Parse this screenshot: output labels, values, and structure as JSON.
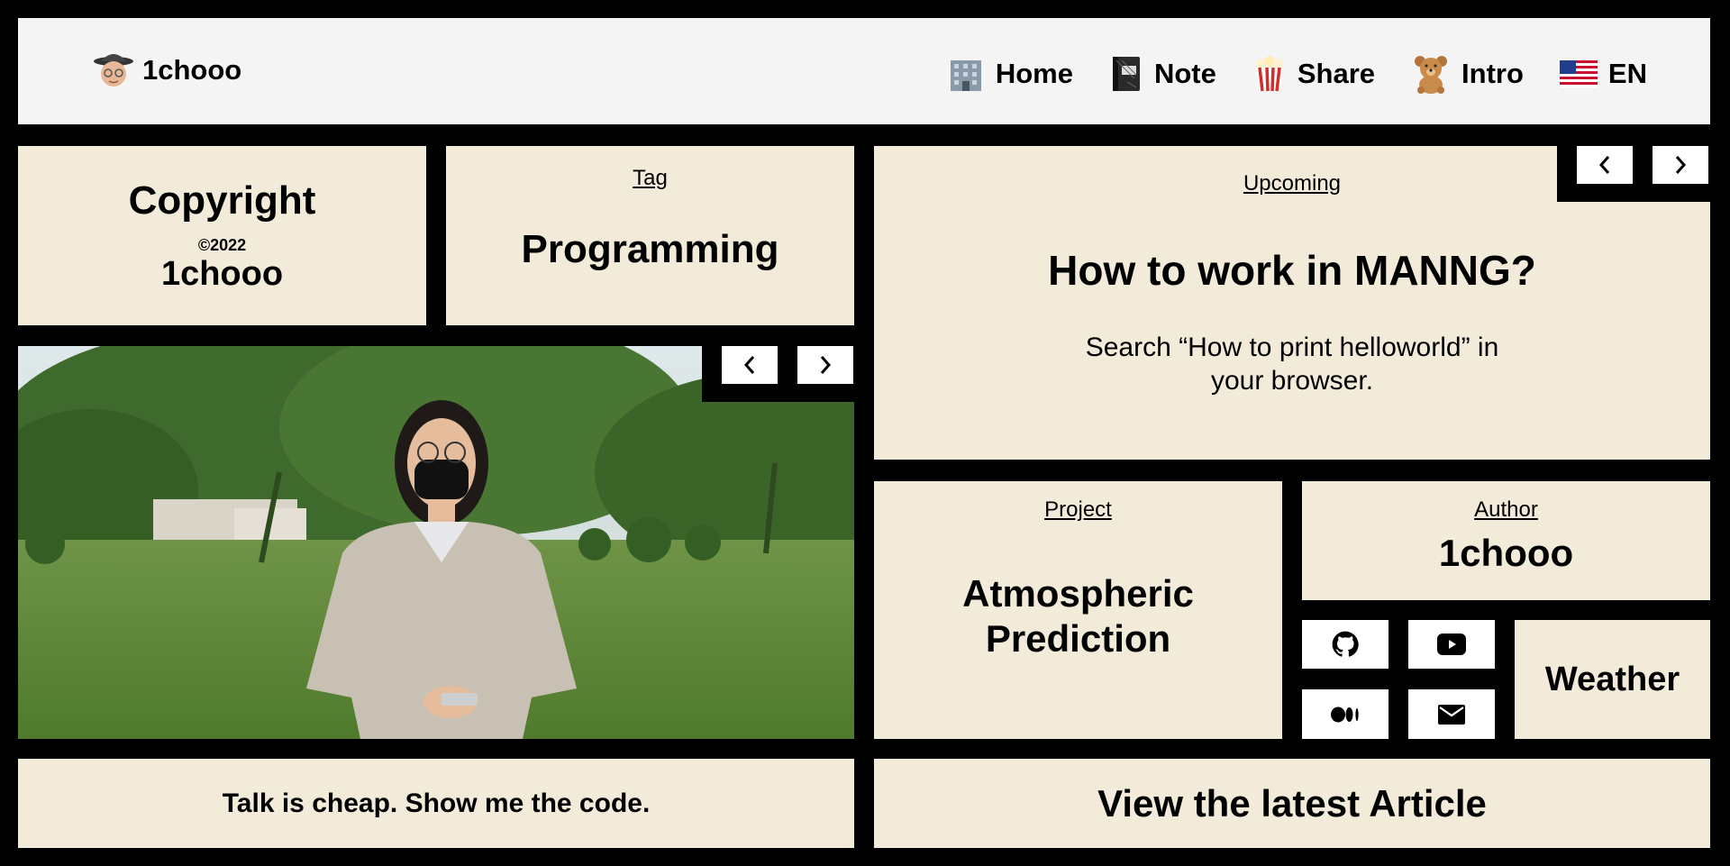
{
  "header": {
    "brand": "1chooo",
    "nav": [
      {
        "label": "Home",
        "icon": "office-building-icon"
      },
      {
        "label": "Note",
        "icon": "notebook-icon"
      },
      {
        "label": "Share",
        "icon": "popcorn-icon"
      },
      {
        "label": "Intro",
        "icon": "teddy-bear-icon"
      },
      {
        "label": "EN",
        "icon": "us-flag-icon"
      }
    ]
  },
  "copyright": {
    "title": "Copyright",
    "year": "©2022",
    "name": "1chooo"
  },
  "tag": {
    "label": "Tag",
    "value": "Programming"
  },
  "upcoming": {
    "label": "Upcoming",
    "title": "How to work in MANNG?",
    "line1": "Search “How to print helloworld” in",
    "line2": "your browser."
  },
  "project": {
    "label": "Project",
    "line1": "Atmospheric",
    "line2": "Prediction"
  },
  "author": {
    "label": "Author",
    "name": "1chooo"
  },
  "weather": {
    "label": "Weather"
  },
  "quote": {
    "text": "Talk is cheap. Show me the code."
  },
  "article": {
    "text": "View the latest Article"
  },
  "social": [
    "github-icon",
    "youtube-icon",
    "medium-icon",
    "mail-icon"
  ],
  "colors": {
    "card": "#f2ebda",
    "header": "#f4f4f4",
    "background": "#000000"
  }
}
